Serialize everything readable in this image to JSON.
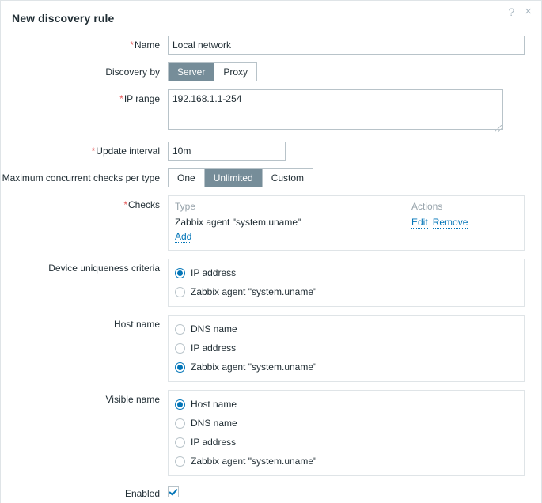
{
  "dialog": {
    "title": "New discovery rule",
    "help_icon_label": "?",
    "close_icon_label": "×"
  },
  "required_marker": "*",
  "fields": {
    "name": {
      "label": "Name",
      "required": true,
      "value": "Local network",
      "placeholder": ""
    },
    "discovery_by": {
      "label": "Discovery by",
      "options": [
        "Server",
        "Proxy"
      ],
      "selected": "Server"
    },
    "ip_range": {
      "label": "IP range",
      "required": true,
      "value": "192.168.1.1-254",
      "placeholder": ""
    },
    "update_interval": {
      "label": "Update interval",
      "required": true,
      "value": "10m",
      "placeholder": ""
    },
    "max_concurrent_checks": {
      "label": "Maximum concurrent checks per type",
      "options": [
        "One",
        "Unlimited",
        "Custom"
      ],
      "selected": "Unlimited"
    },
    "checks": {
      "label": "Checks",
      "required": true,
      "columns": [
        "Type",
        "Actions"
      ],
      "rows": [
        {
          "type": "Zabbix agent \"system.uname\"",
          "actions": [
            "Edit",
            "Remove"
          ]
        }
      ],
      "add_label": "Add"
    },
    "device_uniqueness": {
      "label": "Device uniqueness criteria",
      "options": [
        "IP address",
        "Zabbix agent \"system.uname\""
      ],
      "selected": "IP address"
    },
    "host_name": {
      "label": "Host name",
      "options": [
        "DNS name",
        "IP address",
        "Zabbix agent \"system.uname\""
      ],
      "selected": "Zabbix agent \"system.uname\""
    },
    "visible_name": {
      "label": "Visible name",
      "options": [
        "Host name",
        "DNS name",
        "IP address",
        "Zabbix agent \"system.uname\""
      ],
      "selected": "Host name"
    },
    "enabled": {
      "label": "Enabled",
      "checked": true
    }
  },
  "colors": {
    "accent": "#0275b8",
    "selected_segment_bg": "#768d99",
    "required_asterisk": "#e45959",
    "text": "#1f2c33",
    "muted": "#97a3ab",
    "border": "#b8c3c9",
    "panel_border": "#dfe4e7"
  }
}
